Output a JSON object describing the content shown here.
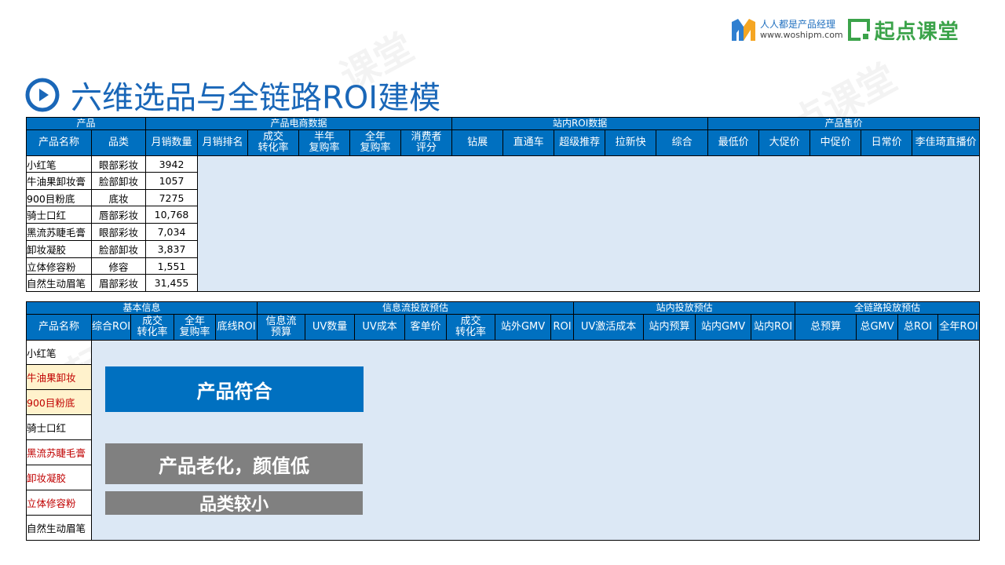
{
  "brand": {
    "woshipm_cn": "人人都是产品经理",
    "woshipm_url": "www.woshipm.com",
    "qidian": "起点课堂"
  },
  "title": "六维选品与全链路ROI建模",
  "colors": {
    "header_blue": "#0070c0",
    "fill_blue": "#dce8f5",
    "gray": "#808080",
    "red_text": "#c00000",
    "yellow": "#fff2cc"
  },
  "table1": {
    "groups": [
      "产品",
      "产品电商数据",
      "站内ROI数据",
      "产品售价"
    ],
    "columns": [
      "产品名称",
      "品类",
      "月销数量",
      "月销排名",
      "成交\n转化率",
      "半年\n复购率",
      "全年\n复购率",
      "消费者\n评分",
      "钻展",
      "直通车",
      "超级推荐",
      "拉新快",
      "综合",
      "最低价",
      "大促价",
      "中促价",
      "日常价",
      "李佳琦直播价"
    ],
    "rows": [
      {
        "name": "小红笔",
        "category": "眼部彩妆",
        "sales": "3942"
      },
      {
        "name": "牛油果卸妆膏",
        "category": "脸部卸妆",
        "sales": "1057"
      },
      {
        "name": "900目粉底",
        "category": "底妆",
        "sales": "7275"
      },
      {
        "name": "骑士口红",
        "category": "唇部彩妆",
        "sales": "10,768"
      },
      {
        "name": "黑流苏睫毛膏",
        "category": "眼部彩妆",
        "sales": "7,034"
      },
      {
        "name": "卸妆凝胶",
        "category": "脸部卸妆",
        "sales": "3,837"
      },
      {
        "name": "立体修容粉",
        "category": "修容",
        "sales": "1,551"
      },
      {
        "name": "自然生动眉笔",
        "category": "眉部彩妆",
        "sales": "31,455"
      }
    ]
  },
  "table2": {
    "groups": [
      "基本信息",
      "信息流投放预估",
      "站内投放预估",
      "全链路投放预估"
    ],
    "columns": [
      "产品名称",
      "综合ROI",
      "成交\n转化率",
      "全年\n复购率",
      "底线ROI",
      "信息流\n预算",
      "UV数量",
      "UV成本",
      "客单价",
      "成交\n转化率",
      "站外GMV",
      "ROI",
      "UV激活成本",
      "站内预算",
      "站内GMV",
      "站内ROI",
      "总预算",
      "总GMV",
      "总ROI",
      "全年ROI"
    ],
    "rows": [
      {
        "name": "小红笔",
        "style": "normal"
      },
      {
        "name": "牛油果卸妆",
        "style": "red-yellow"
      },
      {
        "name": "900目粉底",
        "style": "red-yellow"
      },
      {
        "name": "骑士口红",
        "style": "normal"
      },
      {
        "name": "黑流苏睫毛膏",
        "style": "red"
      },
      {
        "name": "卸妆凝胶",
        "style": "red"
      },
      {
        "name": "立体修容粉",
        "style": "red"
      },
      {
        "name": "自然生动眉笔",
        "style": "normal"
      }
    ]
  },
  "labels": {
    "fit": "产品符合",
    "aging": "产品老化，颜值低",
    "small": "品类较小"
  }
}
